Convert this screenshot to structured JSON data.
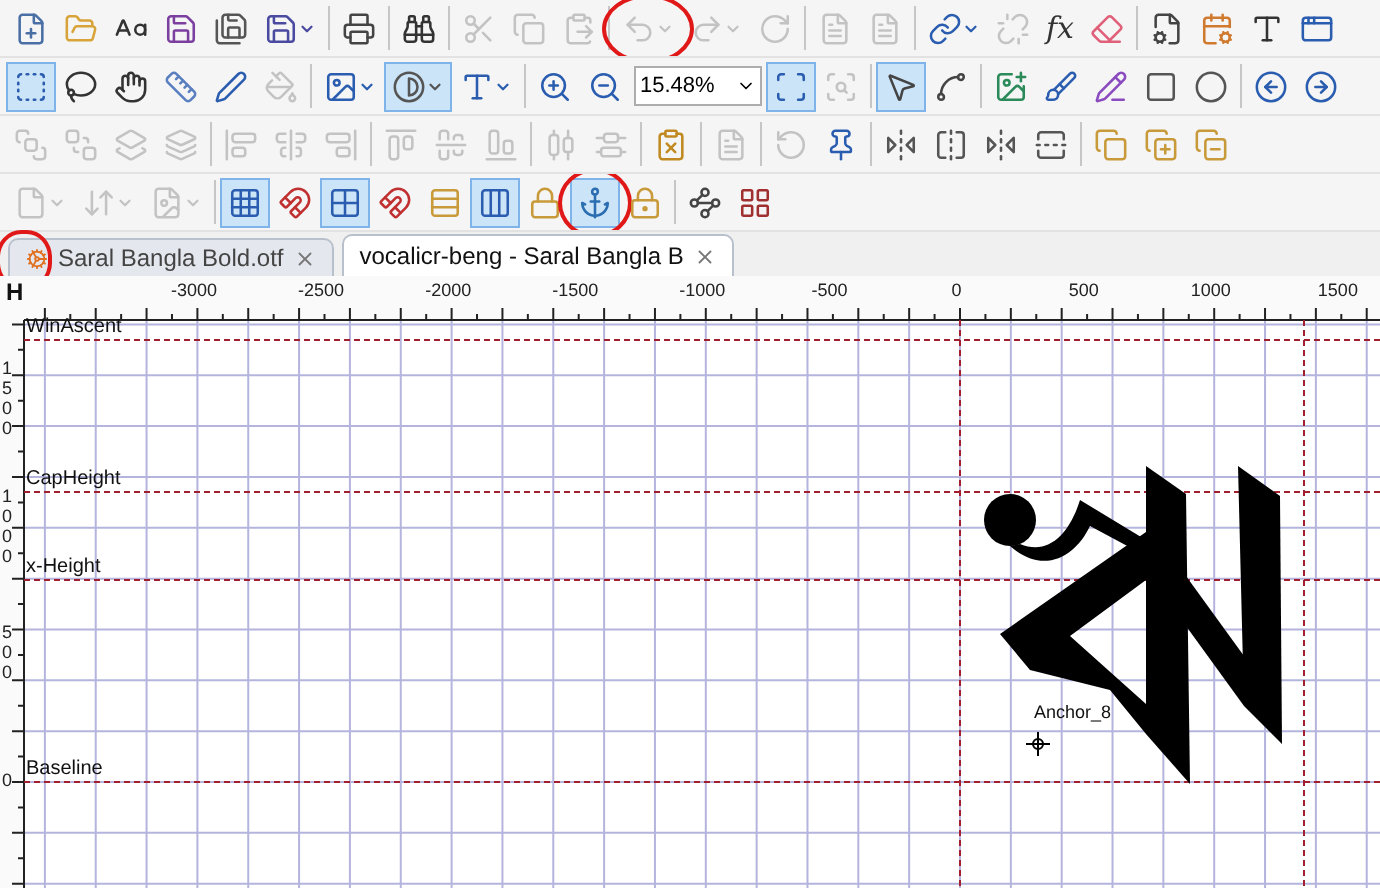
{
  "toolbars": [
    {
      "groups": [
        [
          {
            "kind": "button",
            "active": false,
            "disabled": false,
            "circled": false
          },
          {
            "kind": "button",
            "active": false,
            "disabled": false,
            "circled": false
          },
          {
            "kind": "button",
            "active": false,
            "disabled": false,
            "circled": false
          },
          {
            "kind": "button",
            "active": false,
            "disabled": false,
            "circled": false
          },
          {
            "kind": "button",
            "active": false,
            "disabled": false,
            "circled": false
          },
          {
            "kind": "dropdown",
            "active": false,
            "disabled": false,
            "circled": false
          }
        ],
        [
          {
            "kind": "button",
            "active": false,
            "disabled": false,
            "circled": false
          }
        ],
        [
          {
            "kind": "button",
            "active": false,
            "disabled": false,
            "circled": false
          }
        ],
        [
          {
            "kind": "button",
            "active": false,
            "disabled": true,
            "circled": false
          },
          {
            "kind": "button",
            "active": false,
            "disabled": true,
            "circled": false
          },
          {
            "kind": "button",
            "active": false,
            "disabled": true,
            "circled": false
          }
        ],
        [
          {
            "kind": "dropdown",
            "active": false,
            "disabled": true,
            "circled": true
          },
          {
            "kind": "dropdown",
            "active": false,
            "disabled": true,
            "circled": false
          },
          {
            "kind": "button",
            "active": false,
            "disabled": true,
            "circled": false
          }
        ],
        [
          {
            "kind": "button",
            "active": false,
            "disabled": true,
            "circled": false
          },
          {
            "kind": "button",
            "active": false,
            "disabled": true,
            "circled": false
          }
        ],
        [
          {
            "kind": "dropdown",
            "active": false,
            "disabled": false,
            "circled": false
          },
          {
            "kind": "button",
            "active": false,
            "disabled": true,
            "circled": false
          },
          {
            "kind": "text",
            "label": "fx",
            "active": false,
            "disabled": false,
            "circled": false
          },
          {
            "kind": "button",
            "active": false,
            "disabled": false,
            "circled": false
          }
        ],
        [
          {
            "kind": "button",
            "active": false,
            "disabled": false,
            "circled": false
          },
          {
            "kind": "button",
            "active": false,
            "disabled": false,
            "circled": false
          },
          {
            "kind": "button",
            "active": false,
            "disabled": false,
            "circled": false
          },
          {
            "kind": "button",
            "active": false,
            "disabled": false,
            "circled": false
          }
        ]
      ]
    },
    {
      "groups": [
        [
          {
            "kind": "button",
            "active": true,
            "disabled": false,
            "circled": false
          },
          {
            "kind": "button",
            "active": false,
            "disabled": false,
            "circled": false
          },
          {
            "kind": "button",
            "active": false,
            "disabled": false,
            "circled": false
          },
          {
            "kind": "button",
            "active": false,
            "disabled": false,
            "circled": false
          },
          {
            "kind": "button",
            "active": false,
            "disabled": false,
            "circled": false
          },
          {
            "kind": "button",
            "active": false,
            "disabled": true,
            "circled": false
          }
        ],
        [
          {
            "kind": "dropdown",
            "active": false,
            "disabled": false,
            "circled": false
          },
          {
            "kind": "dropdown",
            "active": true,
            "disabled": false,
            "circled": false
          },
          {
            "kind": "dropdown",
            "active": false,
            "disabled": false,
            "circled": false
          }
        ],
        [
          {
            "kind": "button",
            "active": false,
            "disabled": false,
            "circled": false
          },
          {
            "kind": "button",
            "active": false,
            "disabled": false,
            "circled": false
          },
          {
            "kind": "field",
            "value": "15.48%"
          },
          {
            "kind": "button",
            "active": true,
            "disabled": false,
            "circled": false
          },
          {
            "kind": "button",
            "active": false,
            "disabled": true,
            "circled": false
          }
        ],
        [
          {
            "kind": "button",
            "active": true,
            "disabled": false,
            "circled": false
          },
          {
            "kind": "button",
            "active": false,
            "disabled": false,
            "circled": false
          }
        ],
        [
          {
            "kind": "button",
            "active": false,
            "disabled": false,
            "circled": false
          },
          {
            "kind": "button",
            "active": false,
            "disabled": false,
            "circled": false
          },
          {
            "kind": "button",
            "active": false,
            "disabled": false,
            "circled": false
          },
          {
            "kind": "button",
            "active": false,
            "disabled": false,
            "circled": false
          },
          {
            "kind": "button",
            "active": false,
            "disabled": false,
            "circled": false
          }
        ],
        [
          {
            "kind": "button",
            "active": false,
            "disabled": false,
            "circled": false
          },
          {
            "kind": "button",
            "active": false,
            "disabled": false,
            "circled": false
          }
        ]
      ]
    },
    {
      "groups": [
        [
          {
            "kind": "button",
            "active": false,
            "disabled": true,
            "circled": false
          },
          {
            "kind": "button",
            "active": false,
            "disabled": true,
            "circled": false
          },
          {
            "kind": "button",
            "active": false,
            "disabled": true,
            "circled": false
          },
          {
            "kind": "button",
            "active": false,
            "disabled": true,
            "circled": false
          }
        ],
        [
          {
            "kind": "button",
            "active": false,
            "disabled": true,
            "circled": false
          },
          {
            "kind": "button",
            "active": false,
            "disabled": true,
            "circled": false
          },
          {
            "kind": "button",
            "active": false,
            "disabled": true,
            "circled": false
          }
        ],
        [
          {
            "kind": "button",
            "active": false,
            "disabled": true,
            "circled": false
          },
          {
            "kind": "button",
            "active": false,
            "disabled": true,
            "circled": false
          },
          {
            "kind": "button",
            "active": false,
            "disabled": true,
            "circled": false
          }
        ],
        [
          {
            "kind": "button",
            "active": false,
            "disabled": true,
            "circled": false
          },
          {
            "kind": "button",
            "active": false,
            "disabled": true,
            "circled": false
          }
        ],
        [
          {
            "kind": "button",
            "active": false,
            "disabled": false,
            "circled": false
          }
        ],
        [
          {
            "kind": "button",
            "active": false,
            "disabled": true,
            "circled": false
          }
        ],
        [
          {
            "kind": "button",
            "active": false,
            "disabled": true,
            "circled": false
          },
          {
            "kind": "button",
            "active": false,
            "disabled": false,
            "circled": false
          }
        ],
        [
          {
            "kind": "button",
            "active": false,
            "disabled": false,
            "circled": false
          },
          {
            "kind": "button",
            "active": false,
            "disabled": false,
            "circled": false
          },
          {
            "kind": "button",
            "active": false,
            "disabled": false,
            "circled": false
          },
          {
            "kind": "button",
            "active": false,
            "disabled": false,
            "circled": false
          }
        ],
        [
          {
            "kind": "button",
            "active": false,
            "disabled": false,
            "circled": false
          },
          {
            "kind": "button",
            "active": false,
            "disabled": false,
            "circled": false
          },
          {
            "kind": "button",
            "active": false,
            "disabled": false,
            "circled": false
          }
        ]
      ]
    },
    {
      "groups": [
        [
          {
            "kind": "dropdown",
            "active": false,
            "disabled": true,
            "circled": false
          },
          {
            "kind": "dropdown",
            "active": false,
            "disabled": true,
            "circled": false
          },
          {
            "kind": "dropdown",
            "active": false,
            "disabled": true,
            "circled": false
          }
        ],
        [
          {
            "kind": "button",
            "active": true,
            "disabled": false,
            "circled": false
          },
          {
            "kind": "button",
            "active": false,
            "disabled": false,
            "circled": false
          },
          {
            "kind": "button",
            "active": true,
            "disabled": false,
            "circled": false
          },
          {
            "kind": "button",
            "active": false,
            "disabled": false,
            "circled": false
          },
          {
            "kind": "button",
            "active": false,
            "disabled": false,
            "circled": false
          },
          {
            "kind": "button",
            "active": true,
            "disabled": false,
            "circled": false
          },
          {
            "kind": "button",
            "active": false,
            "disabled": false,
            "circled": false
          },
          {
            "kind": "button",
            "active": true,
            "disabled": false,
            "circled": true
          },
          {
            "kind": "button",
            "active": false,
            "disabled": false,
            "circled": false
          }
        ],
        [
          {
            "kind": "button",
            "active": false,
            "disabled": false,
            "circled": false
          },
          {
            "kind": "button",
            "active": false,
            "disabled": false,
            "circled": false
          }
        ]
      ]
    }
  ],
  "tabs": [
    {
      "kind": "font",
      "label": "Saral Bangla Bold.otf",
      "selected": false,
      "circled": true
    },
    {
      "kind": "glyph",
      "label": "vocalicr-beng - Saral Bangla B",
      "selected": true,
      "circled": false
    }
  ],
  "editor": {
    "corner": "H",
    "x_ruler": [
      "-3000",
      "-2500",
      "-2000",
      "-1500",
      "-1000",
      "-500",
      "0",
      "500",
      "1000",
      "1500"
    ],
    "y_ruler": [
      "1500",
      "1000",
      "500",
      "0"
    ],
    "metrics": [
      {
        "label": "WinAscent"
      },
      {
        "label": "CapHeight"
      },
      {
        "label": "x-Height"
      },
      {
        "label": "Baseline"
      }
    ],
    "anchor": {
      "label": "Anchor_8"
    }
  }
}
